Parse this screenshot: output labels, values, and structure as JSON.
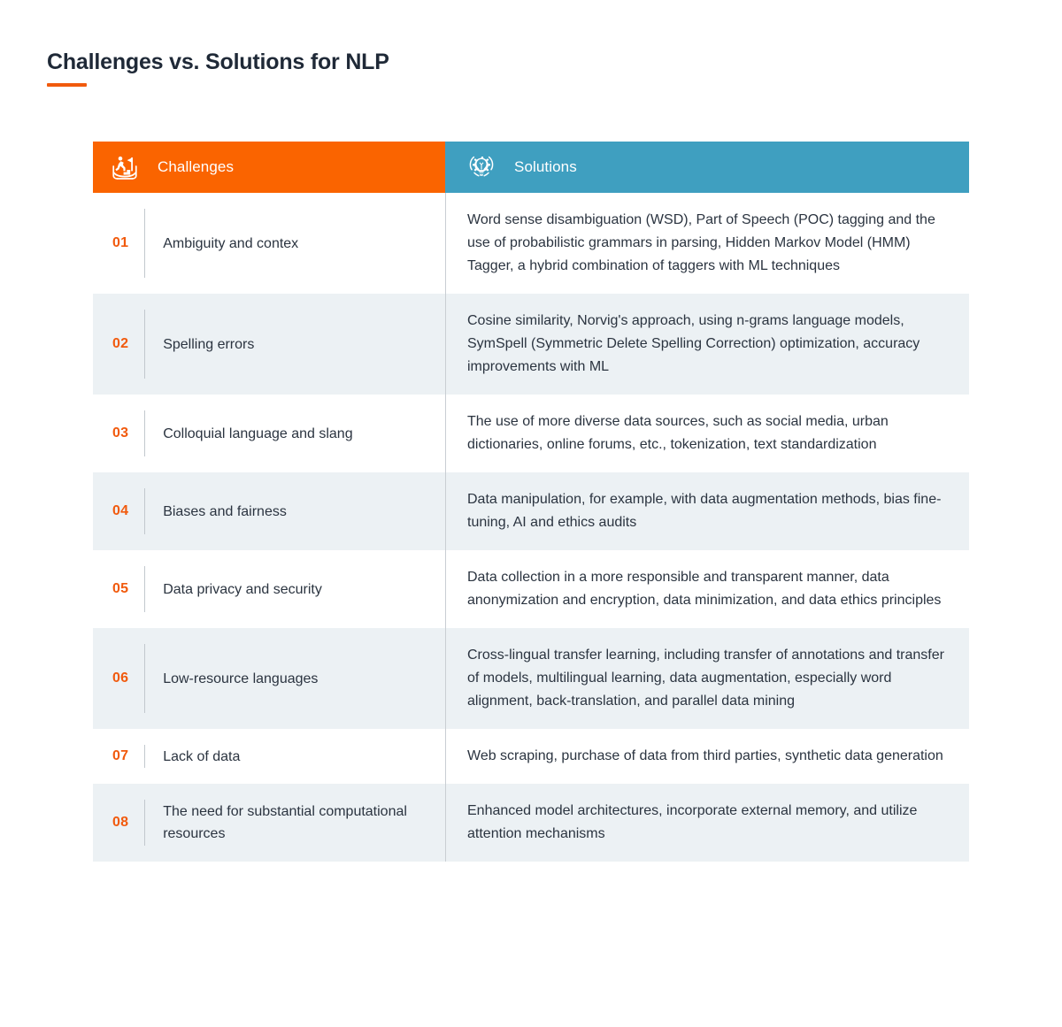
{
  "page": {
    "title": "Challenges vs. Solutions for NLP"
  },
  "colors": {
    "challenges_header_bg": "#fa6400",
    "solutions_header_bg": "#3f9fc0",
    "accent_orange": "#f15a0d",
    "row_alt_bg": "#ecf1f4",
    "text": "#2b3440"
  },
  "table": {
    "headers": {
      "challenges": {
        "label": "Challenges",
        "icon": "person-climbing-to-flag-icon"
      },
      "solutions": {
        "label": "Solutions",
        "icon": "lightbulb-gear-icon"
      }
    },
    "rows": [
      {
        "number": "01",
        "challenge": "Ambiguity and contex",
        "solution": "Word sense disambiguation (WSD), Part of Speech (POC) tagging and the use of probabilistic grammars in parsing, Hidden Markov Model (HMM) Tagger, a hybrid combination of taggers with ML techniques"
      },
      {
        "number": "02",
        "challenge": "Spelling errors",
        "solution": "Cosine similarity, Norvig's approach, using n-grams language models, SymSpell (Symmetric Delete Spelling Correction) optimization, accuracy improvements with ML"
      },
      {
        "number": "03",
        "challenge": "Colloquial language and slang",
        "solution": "The use of more diverse data sources, such as social media, urban dictionaries, online forums, etc., tokenization, text standardization"
      },
      {
        "number": "04",
        "challenge": "Biases and fairness",
        "solution": "Data manipulation, for example, with data augmentation methods, bias fine-tuning, AI and ethics audits"
      },
      {
        "number": "05",
        "challenge": "Data privacy and security",
        "solution": "Data collection in a more responsible and transparent manner, data anonymization and encryption, data minimization, and data ethics principles"
      },
      {
        "number": "06",
        "challenge": "Low-resource languages",
        "solution": "Cross-lingual transfer learning, including transfer of annotations and transfer of models, multilingual learning, data augmentation, especially word alignment, back-translation, and parallel data mining"
      },
      {
        "number": "07",
        "challenge": "Lack of data",
        "solution": "Web scraping, purchase of data from third parties, synthetic data generation"
      },
      {
        "number": "08",
        "challenge": "The need for substantial computational resources",
        "solution": "Enhanced model architectures, incorporate external memory, and utilize attention mechanisms"
      }
    ]
  }
}
